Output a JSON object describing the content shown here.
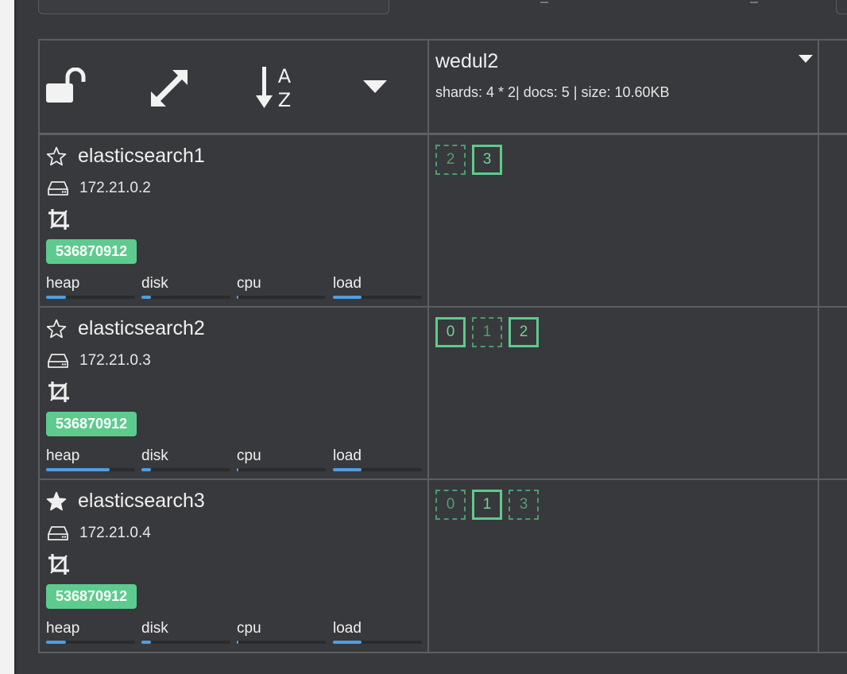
{
  "index": {
    "name": "wedul2",
    "stats": "shards: 4 * 2| docs: 5 | size: 10.60KB"
  },
  "colors": {
    "primary_shard": "#5ecb8e",
    "badge": "#5ecb8e",
    "metric_bar": "#4f9ee0",
    "background": "#38393c"
  },
  "toolbar": {
    "icons": [
      "unlock-icon",
      "expand-icon",
      "sort-alpha-icon",
      "caret-down-icon"
    ]
  },
  "nodes": [
    {
      "name": "elasticsearch1",
      "ip": "172.21.0.2",
      "master": false,
      "badge": "536870912",
      "metrics": [
        {
          "label": "heap",
          "percent": 22
        },
        {
          "label": "disk",
          "percent": 11
        },
        {
          "label": "cpu",
          "percent": 1
        },
        {
          "label": "load",
          "percent": 32
        }
      ],
      "shards": [
        {
          "number": "2",
          "primary": false
        },
        {
          "number": "3",
          "primary": true
        }
      ]
    },
    {
      "name": "elasticsearch2",
      "ip": "172.21.0.3",
      "master": false,
      "badge": "536870912",
      "metrics": [
        {
          "label": "heap",
          "percent": 71
        },
        {
          "label": "disk",
          "percent": 11
        },
        {
          "label": "cpu",
          "percent": 1
        },
        {
          "label": "load",
          "percent": 32
        }
      ],
      "shards": [
        {
          "number": "0",
          "primary": true
        },
        {
          "number": "1",
          "primary": false
        },
        {
          "number": "2",
          "primary": true
        }
      ]
    },
    {
      "name": "elasticsearch3",
      "ip": "172.21.0.4",
      "master": true,
      "badge": "536870912",
      "metrics": [
        {
          "label": "heap",
          "percent": 22
        },
        {
          "label": "disk",
          "percent": 11
        },
        {
          "label": "cpu",
          "percent": 1
        },
        {
          "label": "load",
          "percent": 32
        }
      ],
      "shards": [
        {
          "number": "0",
          "primary": false
        },
        {
          "number": "1",
          "primary": true
        },
        {
          "number": "3",
          "primary": false
        }
      ]
    }
  ]
}
